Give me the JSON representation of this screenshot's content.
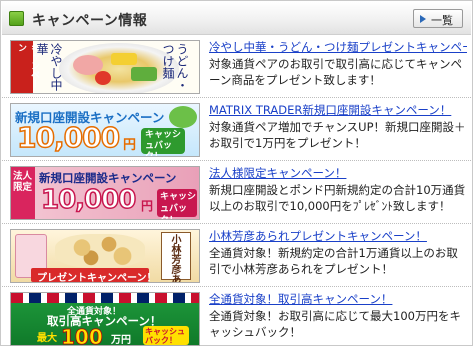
{
  "header": {
    "title": "キャンペーン情報",
    "more_label": "一覧"
  },
  "items": [
    {
      "banner": {
        "side_text": "キャンペーン",
        "cold_text": "冷やし中華",
        "noodle_text": "うどん・つけ麺"
      },
      "title": "冷やし中華・うどん・つけ麺プレゼントキャンペーン！",
      "desc": "対象通貨ペアのお取引で取引高に応じてキャンペーン商品をプレゼント致します！"
    },
    {
      "banner": {
        "title": "新規口座開設キャンペーン",
        "amount": "10,000",
        "yen": "円",
        "cashback": "キャッシュバック！"
      },
      "title": "MATRIX TRADER新規口座開設キャンペーン！",
      "desc": "対象通貨ペア増加でチャンスUP！新規口座開設＋お取引で1万円をプレゼント！"
    },
    {
      "banner": {
        "tag": "法人限定",
        "title": "新規口座開設キャンペーン",
        "amount": "10,000",
        "yen": "円",
        "cashback": "キャッシュバック！"
      },
      "title": "法人様限定キャンペーン！",
      "desc": "新規口座開設とポンド円新規約定の合計10万通貨以上のお取引で10,000円をﾌﾟﾚｾﾞﾝﾄ致します！"
    },
    {
      "banner": {
        "label": "小林芳彦あられ",
        "ribbon": "プレゼントキャンペーン！"
      },
      "title": "小林芳彦あられプレゼントキャンペーン！",
      "desc": "全通貨対象！新規約定の合計1万通貨以上のお取引で小林芳彦あられをプレゼント！"
    },
    {
      "banner": {
        "sub": "全通貨対象！",
        "title": "取引高キャンペーン！",
        "max": "最大",
        "amount": "100",
        "yen": "万円",
        "cashback": "キャッシュバック！"
      },
      "title": "全通貨対象！取引高キャンペーン！",
      "desc": "全通貨対象！お取引高に応じて最大100万円をキャッシュバック！"
    }
  ]
}
